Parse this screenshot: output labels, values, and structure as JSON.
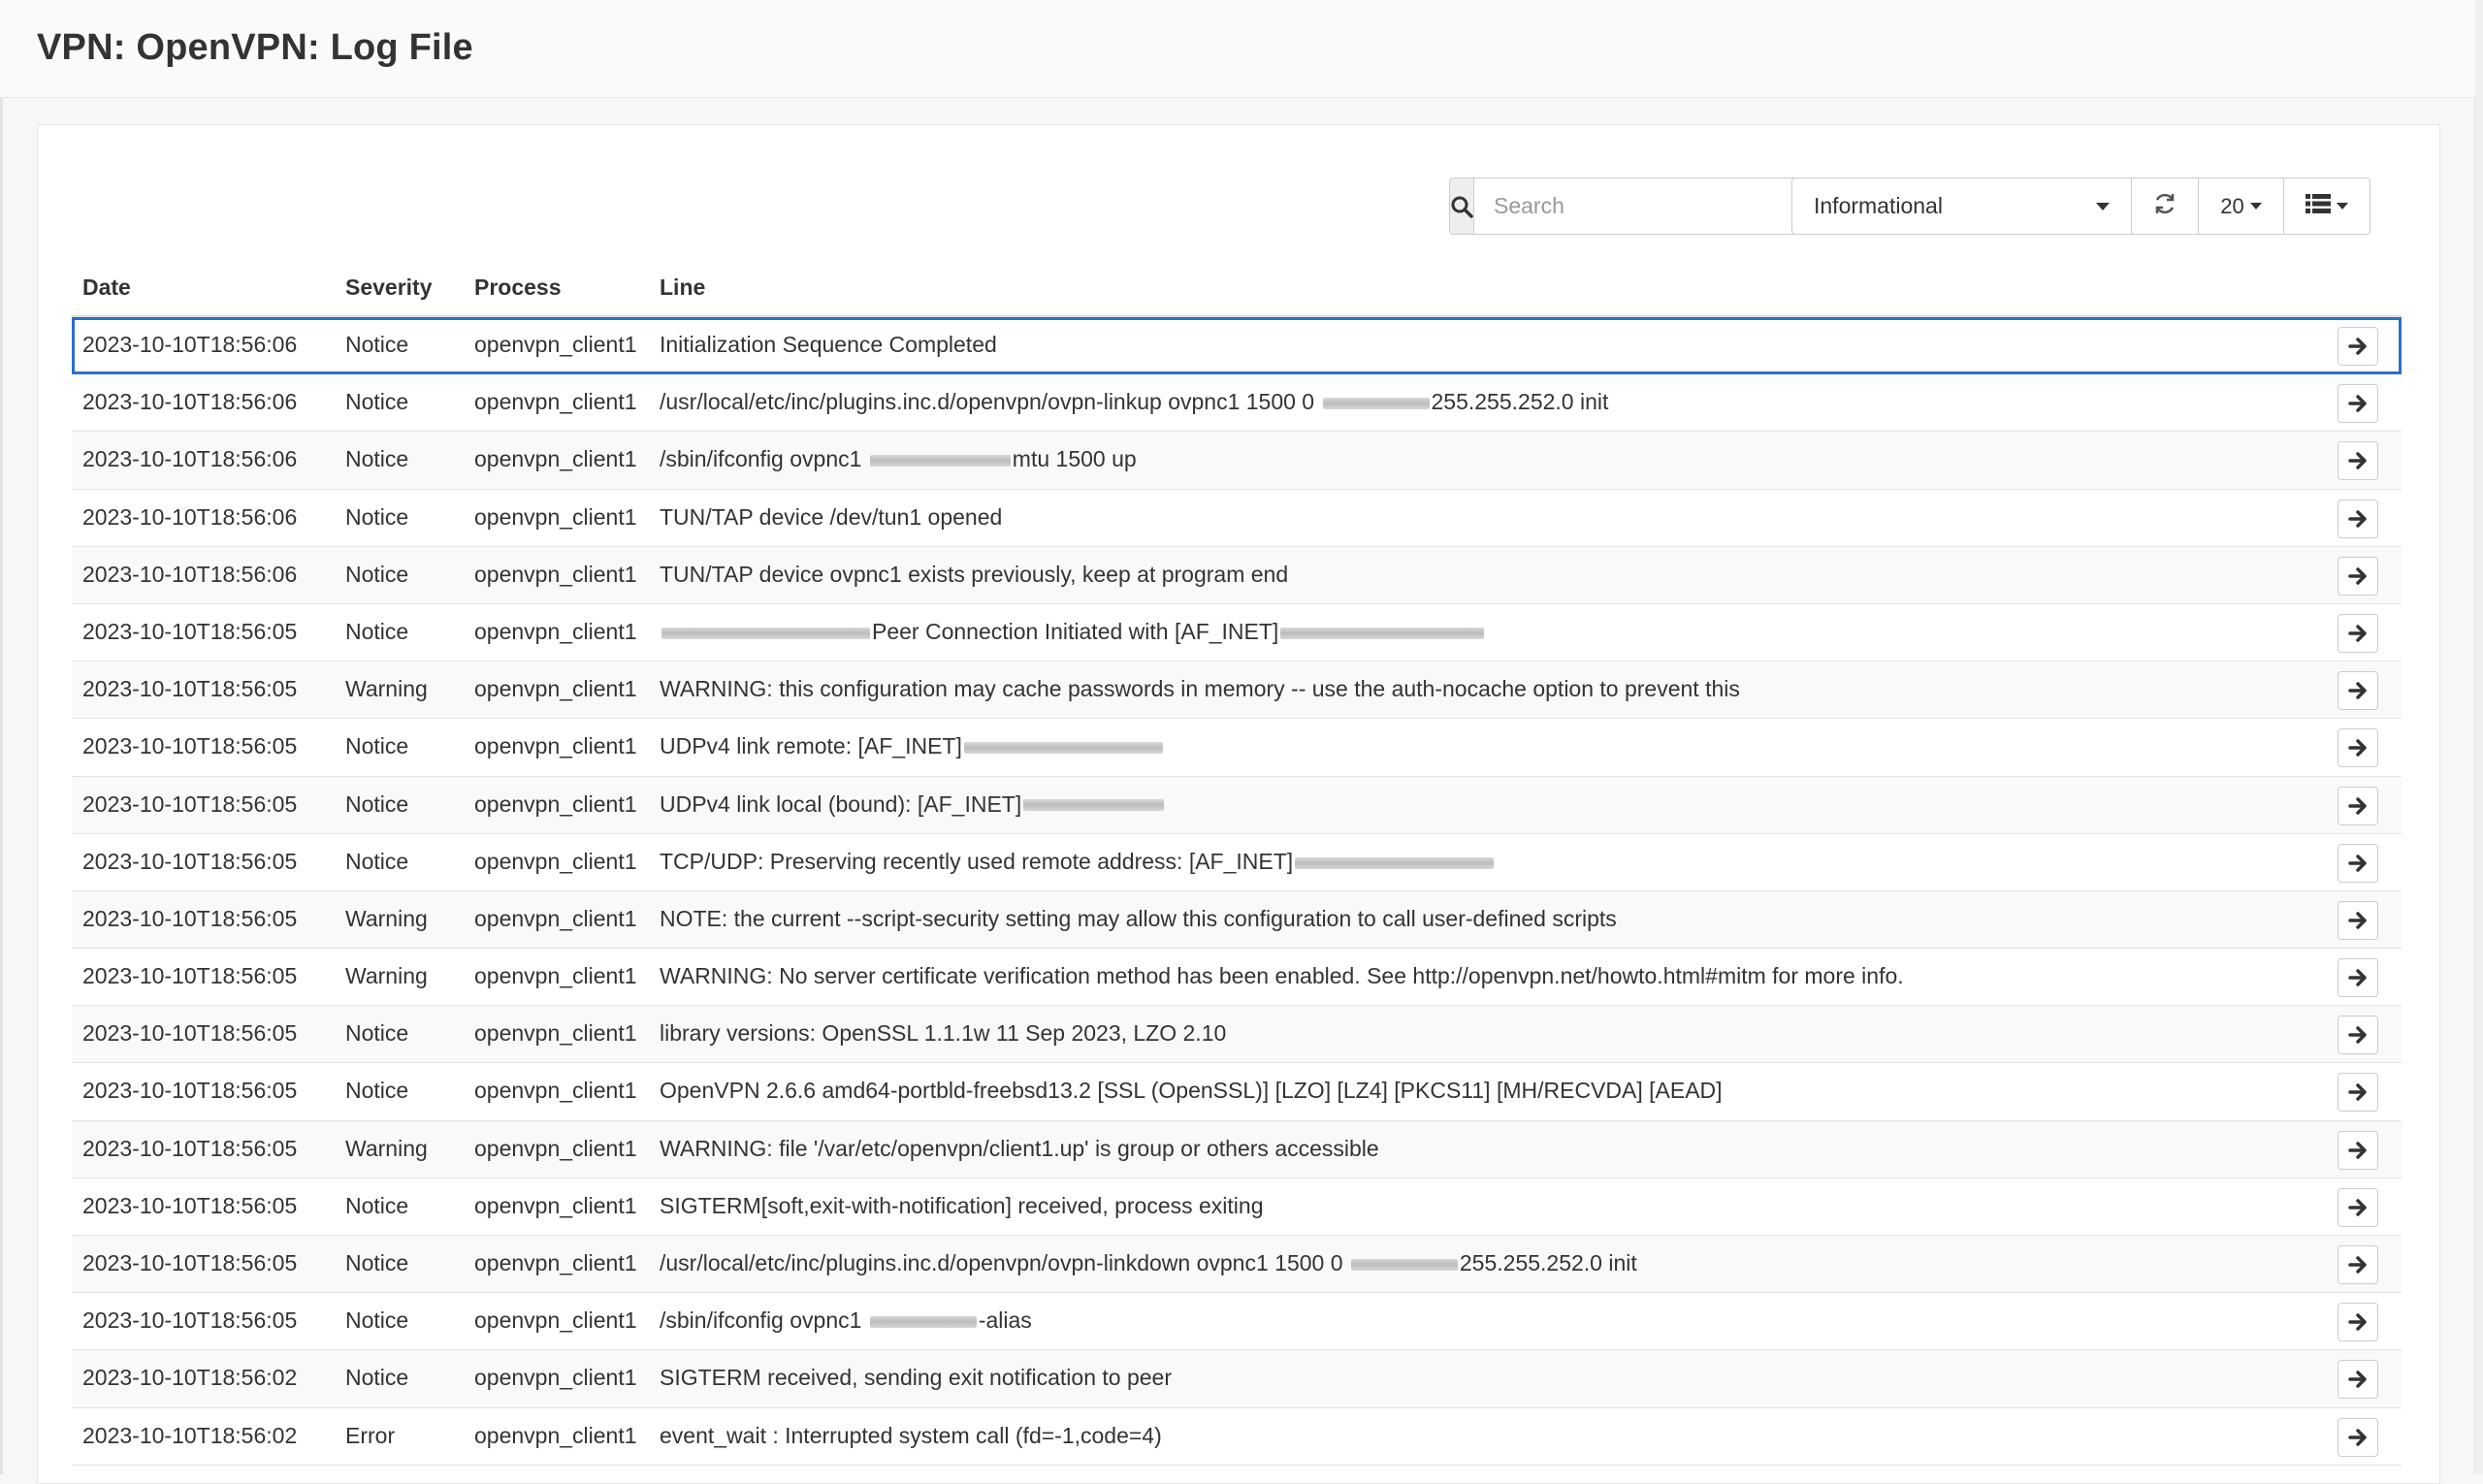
{
  "page": {
    "title": "VPN: OpenVPN: Log File"
  },
  "toolbar": {
    "search_placeholder": "Search",
    "severity_selected": "Informational",
    "rows_per_page": "20",
    "icons": [
      "search-icon",
      "refresh-icon",
      "column-list-icon",
      "chevron-down-icon",
      "arrow-right-icon"
    ]
  },
  "table": {
    "columns": [
      "Date",
      "Severity",
      "Process",
      "Line"
    ],
    "rows": [
      {
        "date": "2023-10-10T18:56:06",
        "severity": "Notice",
        "process": "openvpn_client1",
        "parts": [
          "Initialization Sequence Completed"
        ]
      },
      {
        "date": "2023-10-10T18:56:06",
        "severity": "Notice",
        "process": "openvpn_client1",
        "parts": [
          "/usr/local/etc/inc/plugins.inc.d/openvpn/ovpn-linkup ovpnc1 1500 0 ",
          "255.255.252.0 init"
        ]
      },
      {
        "date": "2023-10-10T18:56:06",
        "severity": "Notice",
        "process": "openvpn_client1",
        "parts": [
          "/sbin/ifconfig ovpnc1 ",
          "mtu 1500 up"
        ]
      },
      {
        "date": "2023-10-10T18:56:06",
        "severity": "Notice",
        "process": "openvpn_client1",
        "parts": [
          "TUN/TAP device /dev/tun1 opened"
        ]
      },
      {
        "date": "2023-10-10T18:56:06",
        "severity": "Notice",
        "process": "openvpn_client1",
        "parts": [
          "TUN/TAP device ovpnc1 exists previously, keep at program end"
        ]
      },
      {
        "date": "2023-10-10T18:56:05",
        "severity": "Notice",
        "process": "openvpn_client1",
        "parts": [
          "",
          "Peer Connection Initiated with [AF_INET]",
          ""
        ]
      },
      {
        "date": "2023-10-10T18:56:05",
        "severity": "Warning",
        "process": "openvpn_client1",
        "parts": [
          "WARNING: this configuration may cache passwords in memory -- use the auth-nocache option to prevent this"
        ]
      },
      {
        "date": "2023-10-10T18:56:05",
        "severity": "Notice",
        "process": "openvpn_client1",
        "parts": [
          "UDPv4 link remote: [AF_INET]",
          ""
        ]
      },
      {
        "date": "2023-10-10T18:56:05",
        "severity": "Notice",
        "process": "openvpn_client1",
        "parts": [
          "UDPv4 link local (bound): [AF_INET]",
          ""
        ]
      },
      {
        "date": "2023-10-10T18:56:05",
        "severity": "Notice",
        "process": "openvpn_client1",
        "parts": [
          "TCP/UDP: Preserving recently used remote address: [AF_INET]",
          ""
        ]
      },
      {
        "date": "2023-10-10T18:56:05",
        "severity": "Warning",
        "process": "openvpn_client1",
        "parts": [
          "NOTE: the current --script-security setting may allow this configuration to call user-defined scripts"
        ]
      },
      {
        "date": "2023-10-10T18:56:05",
        "severity": "Warning",
        "process": "openvpn_client1",
        "parts": [
          "WARNING: No server certificate verification method has been enabled. See http://openvpn.net/howto.html#mitm for more info."
        ]
      },
      {
        "date": "2023-10-10T18:56:05",
        "severity": "Notice",
        "process": "openvpn_client1",
        "parts": [
          "library versions: OpenSSL 1.1.1w 11 Sep 2023, LZO 2.10"
        ]
      },
      {
        "date": "2023-10-10T18:56:05",
        "severity": "Notice",
        "process": "openvpn_client1",
        "parts": [
          "OpenVPN 2.6.6 amd64-portbld-freebsd13.2 [SSL (OpenSSL)] [LZO] [LZ4] [PKCS11] [MH/RECVDA] [AEAD]"
        ]
      },
      {
        "date": "2023-10-10T18:56:05",
        "severity": "Warning",
        "process": "openvpn_client1",
        "parts": [
          "WARNING: file '/var/etc/openvpn/client1.up' is group or others accessible"
        ]
      },
      {
        "date": "2023-10-10T18:56:05",
        "severity": "Notice",
        "process": "openvpn_client1",
        "parts": [
          "SIGTERM[soft,exit-with-notification] received, process exiting"
        ]
      },
      {
        "date": "2023-10-10T18:56:05",
        "severity": "Notice",
        "process": "openvpn_client1",
        "parts": [
          "/usr/local/etc/inc/plugins.inc.d/openvpn/ovpn-linkdown ovpnc1 1500 0 ",
          "255.255.252.0 init"
        ]
      },
      {
        "date": "2023-10-10T18:56:05",
        "severity": "Notice",
        "process": "openvpn_client1",
        "parts": [
          "/sbin/ifconfig ovpnc1 ",
          "-alias"
        ]
      },
      {
        "date": "2023-10-10T18:56:02",
        "severity": "Notice",
        "process": "openvpn_client1",
        "parts": [
          "SIGTERM received, sending exit notification to peer"
        ]
      },
      {
        "date": "2023-10-10T18:56:02",
        "severity": "Error",
        "process": "openvpn_client1",
        "parts": [
          "event_wait : Interrupted system call (fd=-1,code=4)"
        ]
      }
    ]
  },
  "colors": {
    "selection_outline": "#2a6fd1",
    "header_background": "#fafafa",
    "stripe": "#f9f9f9"
  }
}
